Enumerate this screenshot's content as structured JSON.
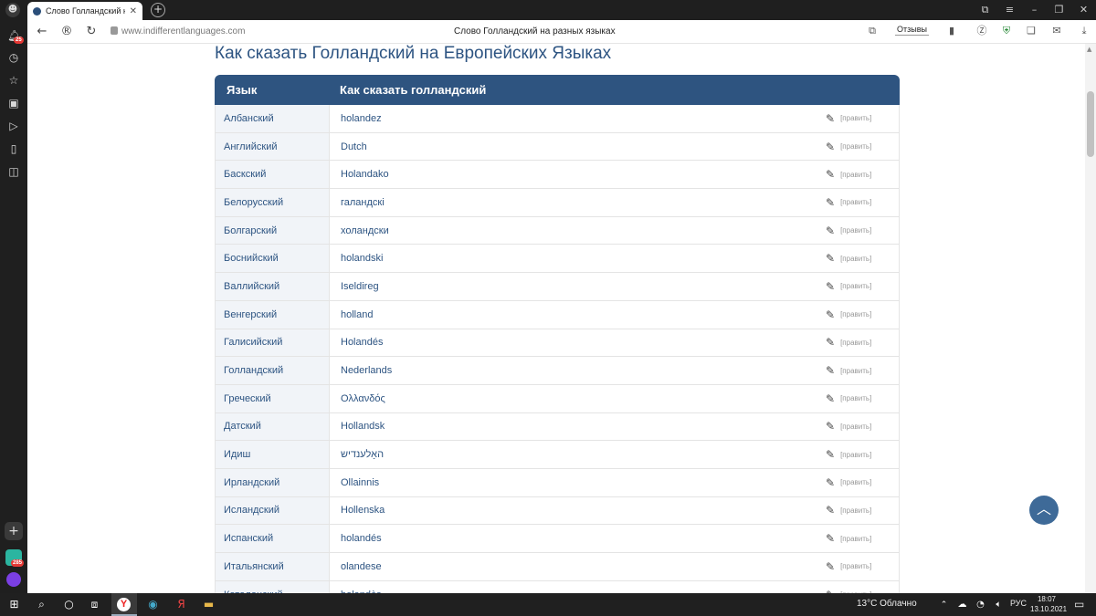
{
  "browser": {
    "tab_title": "Слово Голландский на",
    "tab_close": "✕",
    "new_tab": "+",
    "url": "www.indifferentlanguages.com",
    "page_title": "Слово Голландский на разных языках",
    "reviews_label": "Отзывы",
    "window_controls": [
      "⧉",
      "≡",
      "–",
      "❐",
      "✕"
    ],
    "sidebar_badges": {
      "notifications": "25",
      "app": "285"
    }
  },
  "page": {
    "heading": "Как сказать Голландский на Европейских Языках",
    "table": {
      "headers": {
        "language": "Язык",
        "word": "Как сказать голландский"
      },
      "edit_label": "[править]",
      "rows": [
        {
          "language": "Албанский",
          "word": "holandez"
        },
        {
          "language": "Английский",
          "word": "Dutch"
        },
        {
          "language": "Баскский",
          "word": "Holandako"
        },
        {
          "language": "Белорусский",
          "word": "галандскі"
        },
        {
          "language": "Болгарский",
          "word": "холандски"
        },
        {
          "language": "Боснийский",
          "word": "holandski"
        },
        {
          "language": "Валлийский",
          "word": "Iseldireg"
        },
        {
          "language": "Венгерский",
          "word": "holland"
        },
        {
          "language": "Галисийский",
          "word": "Holandés"
        },
        {
          "language": "Голландский",
          "word": "Nederlands"
        },
        {
          "language": "Греческий",
          "word": "Ολλανδός"
        },
        {
          "language": "Датский",
          "word": "Hollandsk"
        },
        {
          "language": "Идиш",
          "word": "האָלענדיש"
        },
        {
          "language": "Ирландский",
          "word": "Ollainnis"
        },
        {
          "language": "Исландский",
          "word": "Hollenska"
        },
        {
          "language": "Испанский",
          "word": "holandés"
        },
        {
          "language": "Итальянский",
          "word": "olandese"
        },
        {
          "language": "Каталонский",
          "word": "holandès"
        }
      ]
    }
  },
  "taskbar": {
    "weather": "13°C Облачно",
    "language": "РУС",
    "time": "18:07",
    "date": "13.10.2021"
  },
  "colors": {
    "accent": "#2e5480",
    "link": "#2d5482",
    "row_label_bg": "#f1f4f8"
  }
}
